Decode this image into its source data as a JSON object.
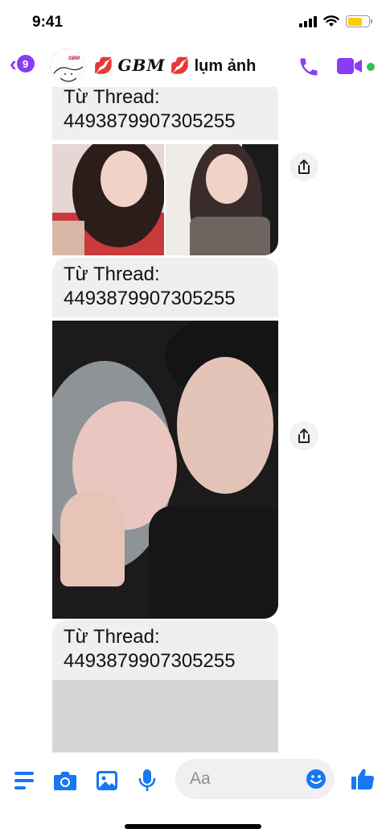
{
  "status_bar": {
    "time": "9:41"
  },
  "header": {
    "back_count": "9",
    "avatar_label": "GBM",
    "title_lips_left": "💋",
    "title_brand": "GBM",
    "title_lips_right": "💋",
    "title_suffix": "lụm ảnh",
    "icons": [
      "back-chevron",
      "phone-icon",
      "video-call-icon"
    ],
    "accent_color": "#8a3cf5",
    "online_color": "#31c048"
  },
  "messages": [
    {
      "line1": "Từ Thread:",
      "line2": "4493879907305255"
    },
    {
      "line1": "Từ Thread:",
      "line2": "4493879907305255"
    },
    {
      "line1": "Từ Thread:",
      "line2": "4493879907305255"
    }
  ],
  "composer": {
    "placeholder": "Aa",
    "icons": [
      "menu-icon",
      "camera-icon",
      "gallery-icon",
      "microphone-icon",
      "emoji-icon",
      "like-icon"
    ],
    "icon_color": "#1877f2"
  }
}
